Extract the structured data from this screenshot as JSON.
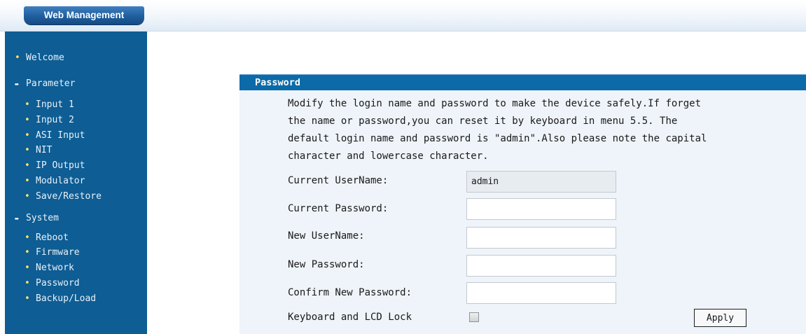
{
  "header": {
    "brand": "Web Management"
  },
  "sidebar": {
    "items": [
      {
        "mark": "•",
        "label": "Welcome"
      },
      {
        "mark": "-",
        "label": "Parameter"
      },
      {
        "mark": "•",
        "label": "Input 1"
      },
      {
        "mark": "•",
        "label": "Input 2"
      },
      {
        "mark": "•",
        "label": "ASI Input"
      },
      {
        "mark": "•",
        "label": "NIT"
      },
      {
        "mark": "•",
        "label": "IP Output"
      },
      {
        "mark": "•",
        "label": "Modulator"
      },
      {
        "mark": "•",
        "label": "Save/Restore"
      },
      {
        "mark": "-",
        "label": "System"
      },
      {
        "mark": "•",
        "label": "Reboot"
      },
      {
        "mark": "•",
        "label": "Firmware"
      },
      {
        "mark": "•",
        "label": "Network"
      },
      {
        "mark": "•",
        "label": "Password"
      },
      {
        "mark": "•",
        "label": "Backup/Load"
      }
    ]
  },
  "panel": {
    "title": "Password",
    "description_lines": [
      "Modify the login name and password to make the device safely.If forget",
      "the name or password,you can reset it by keyboard in menu 5.5. The",
      "default login name and password is \"admin\".Also please note the capital",
      "character and lowercase character."
    ]
  },
  "form": {
    "current_username": {
      "label": "Current UserName:",
      "value": "admin"
    },
    "current_password": {
      "label": "Current Password:",
      "value": ""
    },
    "new_username": {
      "label": "New UserName:",
      "value": ""
    },
    "new_password": {
      "label": "New Password:",
      "value": ""
    },
    "confirm_password": {
      "label": "Confirm New Password:",
      "value": ""
    },
    "lock": {
      "label": "Keyboard and LCD Lock",
      "checked": false
    },
    "apply_label": "Apply"
  },
  "colors": {
    "sidebar_bg": "#0e5d94",
    "header_bar": "#0c6aa8",
    "bullet": "#ffe066",
    "panel_bg": "#eef4f9"
  }
}
